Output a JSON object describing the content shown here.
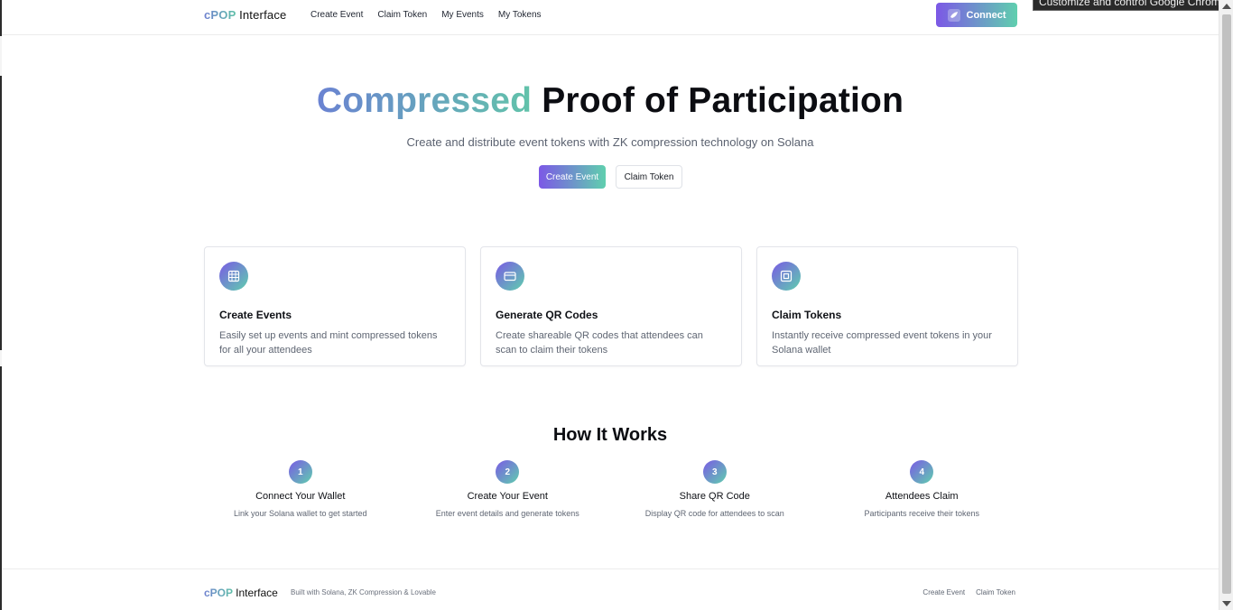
{
  "header": {
    "brand_accent": "cPOP",
    "brand_rest": "Interface",
    "nav": [
      "Create Event",
      "Claim Token",
      "My Events",
      "My Tokens"
    ],
    "connect_label": "Connect"
  },
  "tooltip": "Customize and control Google Chrome",
  "hero": {
    "title_accent": "Compressed",
    "title_rest": "Proof of Participation",
    "subtitle": "Create and distribute event tokens with ZK compression technology on Solana",
    "primary_button": "Create Event",
    "secondary_button": "Claim Token"
  },
  "features": [
    {
      "icon": "calendar-grid-icon",
      "title": "Create Events",
      "desc": "Easily set up events and mint compressed tokens for all your attendees"
    },
    {
      "icon": "card-icon",
      "title": "Generate QR Codes",
      "desc": "Create shareable QR codes that attendees can scan to claim their tokens"
    },
    {
      "icon": "token-square-icon",
      "title": "Claim Tokens",
      "desc": "Instantly receive compressed event tokens in your Solana wallet"
    }
  ],
  "how": {
    "title": "How It Works",
    "steps": [
      {
        "num": "1",
        "title": "Connect Your Wallet",
        "desc": "Link your Solana wallet to get started"
      },
      {
        "num": "2",
        "title": "Create Your Event",
        "desc": "Enter event details and generate tokens"
      },
      {
        "num": "3",
        "title": "Share QR Code",
        "desc": "Display QR code for attendees to scan"
      },
      {
        "num": "4",
        "title": "Attendees Claim",
        "desc": "Participants receive their tokens"
      }
    ]
  },
  "footer": {
    "brand_accent": "cPOP",
    "brand_rest": "Interface",
    "built_with": "Built with Solana, ZK Compression & Lovable",
    "links": [
      "Create Event",
      "Claim Token"
    ]
  },
  "colors": {
    "gradient_start": "#7c58e6",
    "gradient_end": "#5fcfae"
  }
}
